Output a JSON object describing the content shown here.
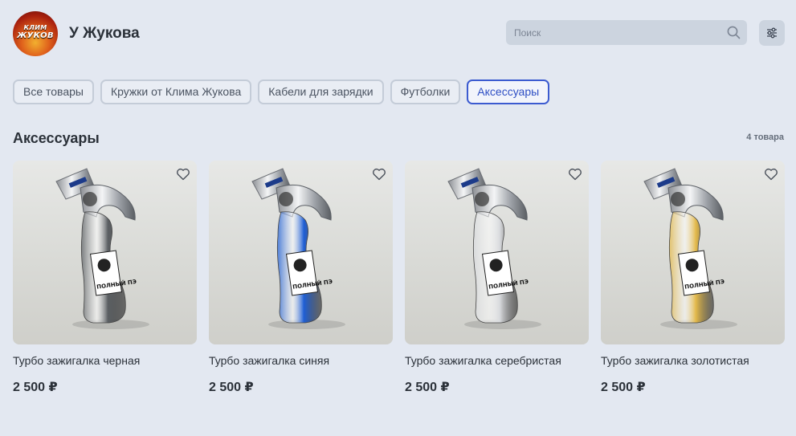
{
  "header": {
    "avatar_line1": "КЛИМ",
    "avatar_line2": "ЖУКОВ",
    "shop_name": "У Жукова",
    "search_placeholder": "Поиск",
    "search_icon": "search-icon",
    "filter_icon": "sliders-icon"
  },
  "tabs": [
    {
      "label": "Все товары",
      "active": false
    },
    {
      "label": "Кружки от Клима Жукова",
      "active": false
    },
    {
      "label": "Кабели для зарядки",
      "active": false
    },
    {
      "label": "Футболки",
      "active": false
    },
    {
      "label": "Аксессуары",
      "active": true
    }
  ],
  "section": {
    "title": "Аксессуары",
    "count": "4 товара"
  },
  "products": [
    {
      "name": "Турбо зажигалка черная",
      "price": "2 500 ₽",
      "color": "#5b5f63",
      "label_text": "ПОЛНЫЙ ПЭ"
    },
    {
      "name": "Турбо зажигалка синяя",
      "price": "2 500 ₽",
      "color": "#1f5fd6",
      "label_text": "ПОЛНЫЙ ПЭ"
    },
    {
      "name": "Турбо зажигалка серебристая",
      "price": "2 500 ₽",
      "color": "#d8dadd",
      "label_text": "ПОЛНЫЙ ПЭ"
    },
    {
      "name": "Турбо зажигалка золотистая",
      "price": "2 500 ₽",
      "color": "#e3b94a",
      "label_text": "ПОЛНЫЙ ПЭ"
    }
  ]
}
